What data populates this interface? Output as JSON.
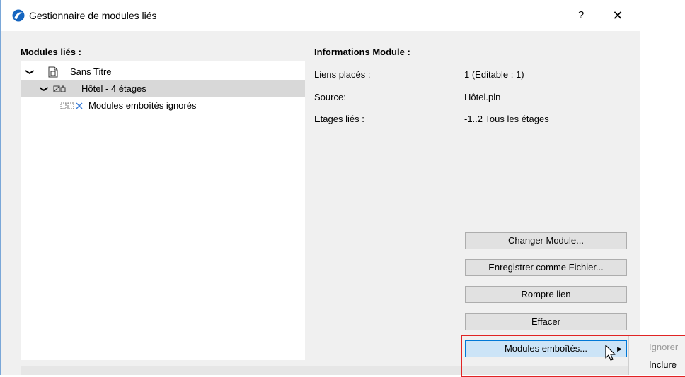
{
  "window": {
    "title": "Gestionnaire de modules liés",
    "help_label": "?",
    "close_label": "✕"
  },
  "tree": {
    "header": "Modules liés :",
    "items": [
      {
        "label": "Sans Titre",
        "icon": "document-icon",
        "expanded": true
      },
      {
        "label": "Hôtel - 4 étages",
        "icon": "module-icon",
        "expanded": true,
        "selected": true
      },
      {
        "label": "Modules emboîtés ignorés",
        "icon": "ignored-modules-icon"
      }
    ]
  },
  "info": {
    "header": "Informations Module :",
    "rows": [
      {
        "label": "Liens placés :",
        "value": "1 (Editable : 1)"
      },
      {
        "label": "Source:",
        "value": "Hôtel.pln"
      },
      {
        "label": "Etages liés :",
        "value": "-1..2 Tous les étages"
      }
    ]
  },
  "buttons": {
    "change": "Changer Module...",
    "save_as_file": "Enregistrer comme Fichier...",
    "break_link": "Rompre lien",
    "delete": "Effacer",
    "nested": "Modules emboîtés..."
  },
  "flyout": {
    "items": [
      {
        "label": "Ignorer",
        "enabled": false
      },
      {
        "label": "Inclure",
        "enabled": true
      }
    ]
  },
  "colors": {
    "highlight": "#e02424",
    "active_button": "#cce4f7",
    "selected_row": "#d8d8d8"
  }
}
